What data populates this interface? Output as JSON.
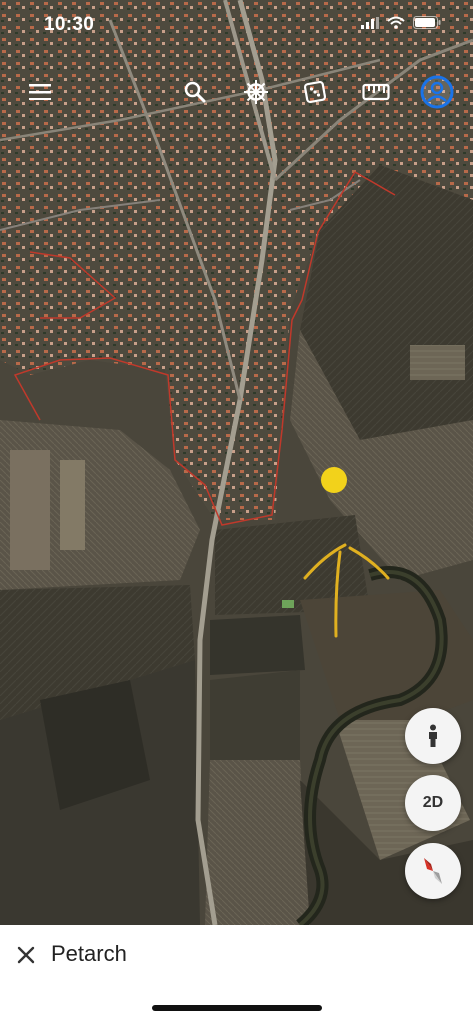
{
  "status_bar": {
    "time": "10:30"
  },
  "toolbar": {
    "menu_icon": "menu-icon",
    "search_icon": "search-icon",
    "voyager_icon": "ship-wheel-icon",
    "random_icon": "dice-icon",
    "measure_icon": "ruler-icon",
    "account_icon": "account-icon"
  },
  "map_controls": {
    "street_view_icon": "person-icon",
    "mode_label": "2D",
    "compass_icon": "compass-icon"
  },
  "bottom_bar": {
    "title": "Petarch",
    "close_icon": "close-icon"
  },
  "colors": {
    "accent": "#1a73e8",
    "boundary": "#c0392b",
    "annotation": "#e0b020",
    "compass_red": "#d93025"
  }
}
